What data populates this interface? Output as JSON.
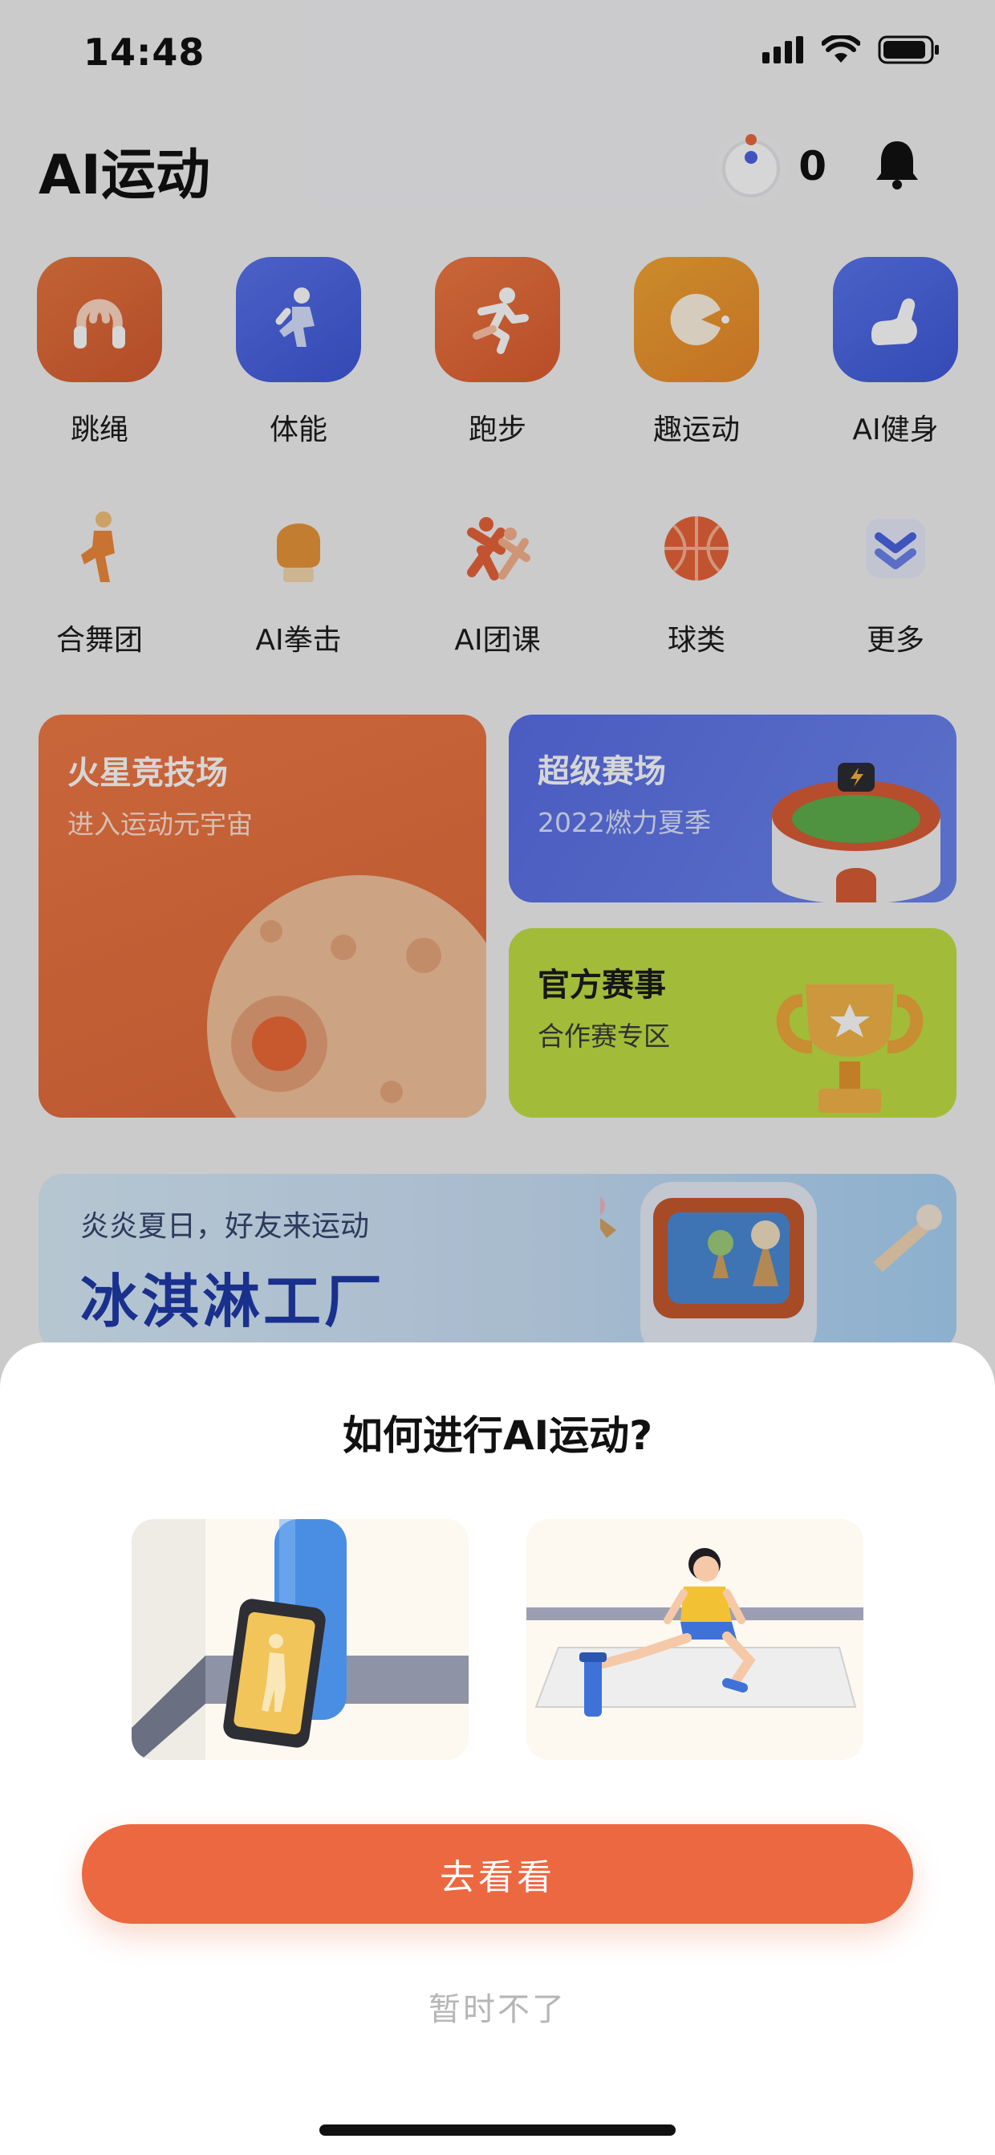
{
  "status_bar": {
    "time": "14:48"
  },
  "header": {
    "title": "AI运动",
    "points": "0"
  },
  "main_grid": [
    {
      "label": "跳绳",
      "icon": "jump-rope-icon",
      "color": "#e0683a"
    },
    {
      "label": "体能",
      "icon": "fitness-icon",
      "color": "#4a64e2"
    },
    {
      "label": "跑步",
      "icon": "running-icon",
      "color": "#e66a3a"
    },
    {
      "label": "趣运动",
      "icon": "fun-sport-icon",
      "color": "#ef9a2a"
    },
    {
      "label": "AI健身",
      "icon": "muscle-icon",
      "color": "#4763e0"
    }
  ],
  "secondary_grid": [
    {
      "label": "合舞团",
      "icon": "dance-icon"
    },
    {
      "label": "AI拳击",
      "icon": "boxing-glove-icon"
    },
    {
      "label": "AI团课",
      "icon": "group-class-icon"
    },
    {
      "label": "球类",
      "icon": "basketball-icon"
    },
    {
      "label": "更多",
      "icon": "chevron-double-down-icon"
    }
  ],
  "cards": {
    "mars": {
      "title": "火星竞技场",
      "subtitle": "进入运动元宇宙"
    },
    "super": {
      "title": "超级赛场",
      "subtitle": "2022燃力夏季"
    },
    "official": {
      "title": "官方赛事",
      "subtitle": "合作赛专区"
    }
  },
  "banner": {
    "subtitle": "炎炎夏日，好友来运动",
    "title": "冰淇淋工厂"
  },
  "sheet": {
    "title": "如何进行AI运动?",
    "primary_button": "去看看",
    "secondary_button": "暂时不了"
  },
  "colors": {
    "accent": "#ec6840",
    "blue": "#4a64e2",
    "lime": "#c2df45"
  }
}
